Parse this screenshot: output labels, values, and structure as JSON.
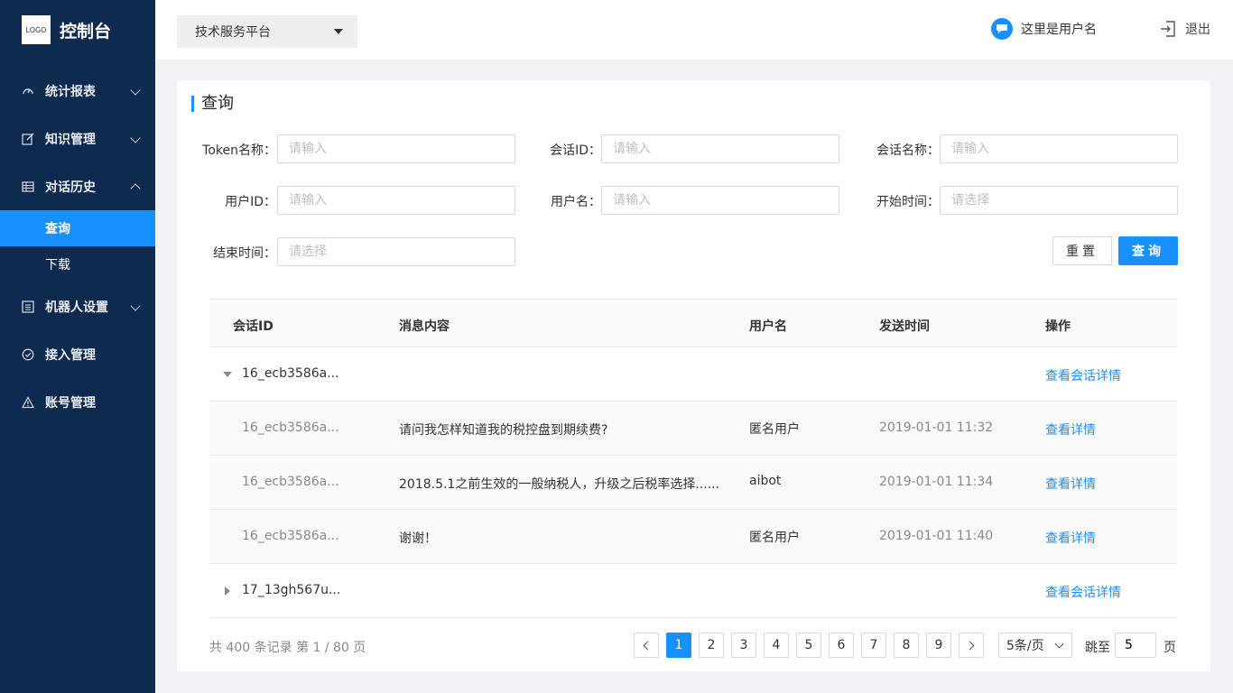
{
  "app": {
    "logo_text": "LOGO",
    "title": "控制台"
  },
  "sidebar": {
    "items": [
      {
        "label": "统计报表"
      },
      {
        "label": "知识管理"
      },
      {
        "label": "对话历史"
      },
      {
        "label": "机器人设置"
      },
      {
        "label": "接入管理"
      },
      {
        "label": "账号管理"
      }
    ],
    "sub_items": [
      {
        "label": "查询"
      },
      {
        "label": "下载"
      }
    ]
  },
  "header": {
    "platform": "技术服务平台",
    "username": "这里是用户名",
    "logout": "退出"
  },
  "query": {
    "title": "查询",
    "fields": [
      {
        "label": "Token名称：",
        "placeholder": "请输入"
      },
      {
        "label": "会话ID：",
        "placeholder": "请输入"
      },
      {
        "label": "会话名称：",
        "placeholder": "请输入"
      },
      {
        "label": "用户ID：",
        "placeholder": "请输入"
      },
      {
        "label": "用户名：",
        "placeholder": "请输入"
      },
      {
        "label": "开始时间：",
        "placeholder": "请选择"
      },
      {
        "label": "结束时间：",
        "placeholder": "请选择"
      }
    ],
    "reset_label": "重置",
    "query_label": "查询"
  },
  "table": {
    "headers": [
      "会话ID",
      "消息内容",
      "用户名",
      "发送时间",
      "操作"
    ],
    "groups": [
      {
        "id": "16_ecb3586a...",
        "action": "查看会话详情",
        "children": [
          {
            "id": "16_ecb3586a...",
            "message": "请问我怎样知道我的税控盘到期续费?",
            "user": "匿名用户",
            "time": "2019-01-01  11:32",
            "action": "查看详情"
          },
          {
            "id": "16_ecb3586a...",
            "message": "2018.5.1之前生效的一般纳税人，升级之后税率选择......",
            "user": "aibot",
            "time": "2019-01-01  11:34",
            "action": "查看详情"
          },
          {
            "id": "16_ecb3586a...",
            "message": "谢谢！",
            "user": "匿名用户",
            "time": "2019-01-01  11:40",
            "action": "查看详情"
          }
        ]
      },
      {
        "id": "17_13gh567u...",
        "action": "查看会话详情"
      }
    ]
  },
  "pagination": {
    "total_text": "共 400 条记录 第 1 / 80 页",
    "pages": [
      "1",
      "2",
      "3",
      "4",
      "5",
      "6",
      "7",
      "8",
      "9"
    ],
    "current": "1",
    "page_size": "5条/页",
    "jump_label": "跳至",
    "jump_value": "5",
    "jump_suffix": "页"
  },
  "colors": {
    "sidebar_bg": "#0f2a4f",
    "accent": "#1890ff"
  }
}
